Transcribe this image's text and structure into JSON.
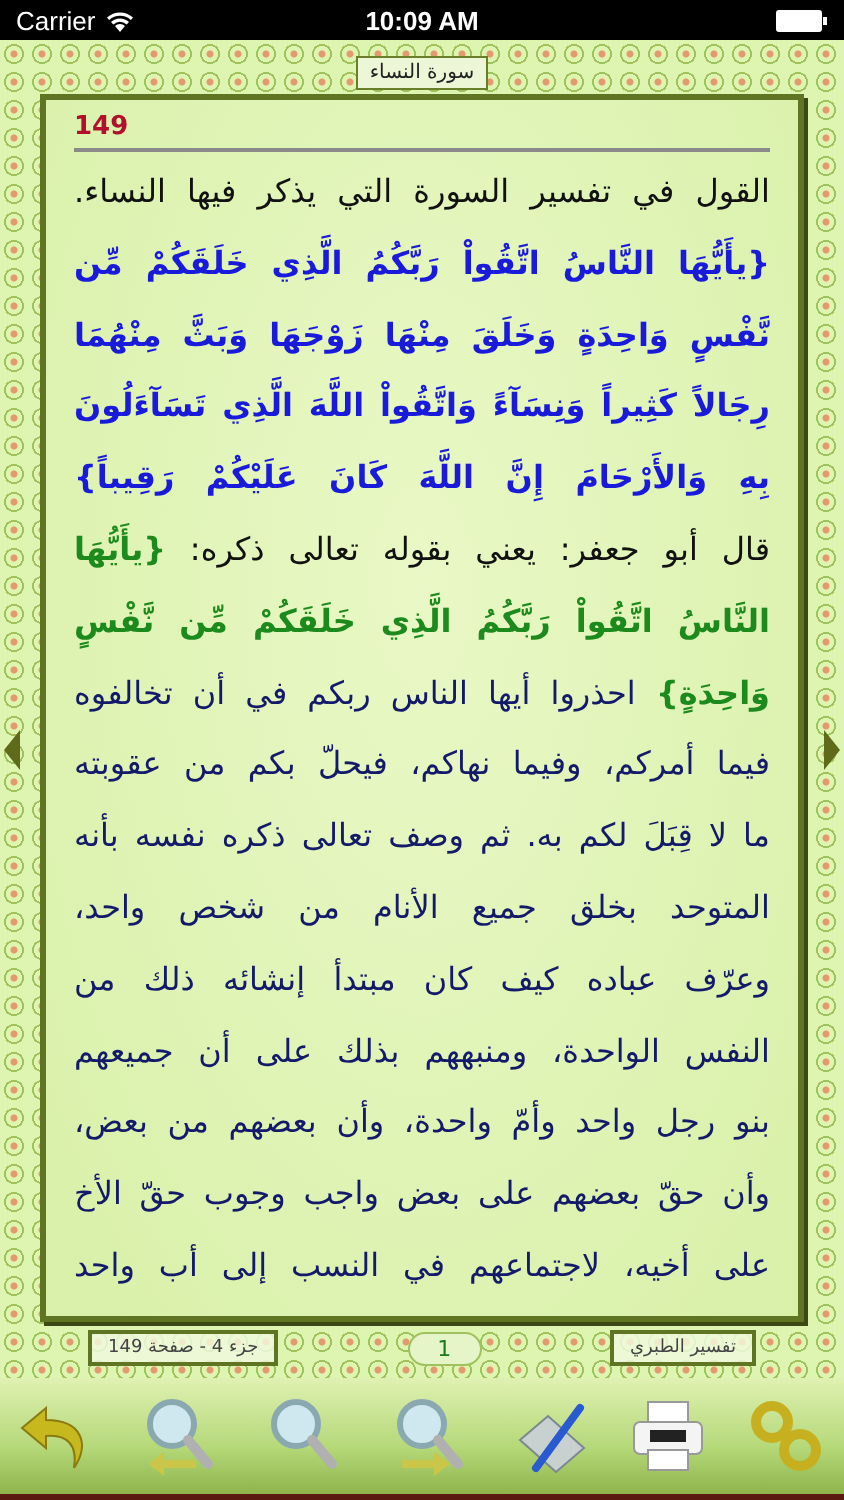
{
  "status_bar": {
    "carrier": "Carrier",
    "time": "10:09 AM"
  },
  "header": {
    "surah": "سورة النساء"
  },
  "page": {
    "number": "149",
    "lines": [
      {
        "segments": [
          {
            "kind": "plain",
            "text": "القول في تفسير السورة التي يذكر فيها النساء."
          }
        ]
      },
      {
        "segments": [
          {
            "kind": "quran",
            "text": "{يأَيُّهَا النَّاسُ اتَّقُواْ رَبَّكُمُ الَّذِي خَلَقَكُمْ مِّن"
          }
        ]
      },
      {
        "segments": [
          {
            "kind": "quran",
            "text": "نَّفْسٍ وَاحِدَةٍ وَخَلَقَ مِنْهَا زَوْجَهَا وَبَثَّ مِنْهُمَا"
          }
        ]
      },
      {
        "segments": [
          {
            "kind": "quran",
            "text": "رِجَالاً كَثِيراً وَنِسَآءً وَاتَّقُواْ اللَّهَ الَّذِي تَسَآءَلُونَ"
          }
        ]
      },
      {
        "segments": [
          {
            "kind": "quran",
            "text": "بِهِ وَالأَرْحَامَ إِنَّ اللَّهَ كَانَ عَلَيْكُمْ رَقِيباً}"
          }
        ]
      },
      {
        "segments": [
          {
            "kind": "plain",
            "text": "قال أبو جعفر: يعني بقوله تعالى ذكره: "
          },
          {
            "kind": "quote",
            "text": "{يأَيُّهَا"
          }
        ]
      },
      {
        "segments": [
          {
            "kind": "quote",
            "text": "النَّاسُ اتَّقُواْ رَبَّكُمُ الَّذِي خَلَقَكُمْ مِّن نَّفْسٍ"
          }
        ]
      },
      {
        "segments": [
          {
            "kind": "quote",
            "text": "وَاحِدَةٍ}"
          },
          {
            "kind": "commentary",
            "text": " احذروا أيها الناس ربكم في أن تخالفوه"
          }
        ]
      },
      {
        "segments": [
          {
            "kind": "commentary",
            "text": "فيما أمركم، وفيما نهاكم، فيحلّ بكم من عقوبته"
          }
        ]
      },
      {
        "segments": [
          {
            "kind": "commentary",
            "text": "ما لا قِبَلَ لكم به. ثم وصف تعالى ذكره نفسه بأنه"
          }
        ]
      },
      {
        "segments": [
          {
            "kind": "commentary",
            "text": "المتوحد بخلق جميع الأنام من شخص واحد،"
          }
        ]
      },
      {
        "segments": [
          {
            "kind": "commentary",
            "text": "وعرّف عباده كيف كان مبتدأ إنشائه ذلك من"
          }
        ]
      },
      {
        "segments": [
          {
            "kind": "commentary",
            "text": "النفس الواحدة، ومنبههم بذلك على أن جميعهم"
          }
        ]
      },
      {
        "segments": [
          {
            "kind": "commentary",
            "text": "بنو رجل واحد وأمّ واحدة، وأن بعضهم من بعض،"
          }
        ]
      },
      {
        "segments": [
          {
            "kind": "commentary",
            "text": "وأن حقّ بعضهم على بعض واجب وجوب حقّ الأخ"
          }
        ]
      },
      {
        "segments": [
          {
            "kind": "commentary",
            "text": "على أخيه، لاجتماعهم في النسب إلى أب واحد"
          }
        ]
      }
    ]
  },
  "footer": {
    "location": "جزء 4  -  صفحة 149",
    "counter": "1",
    "book": "تفسير الطبري"
  },
  "toolbar": [
    {
      "kind": "undo"
    },
    {
      "kind": "search_previous"
    },
    {
      "kind": "search"
    },
    {
      "kind": "search_next"
    },
    {
      "kind": "notes"
    },
    {
      "kind": "print"
    },
    {
      "kind": "link"
    }
  ]
}
